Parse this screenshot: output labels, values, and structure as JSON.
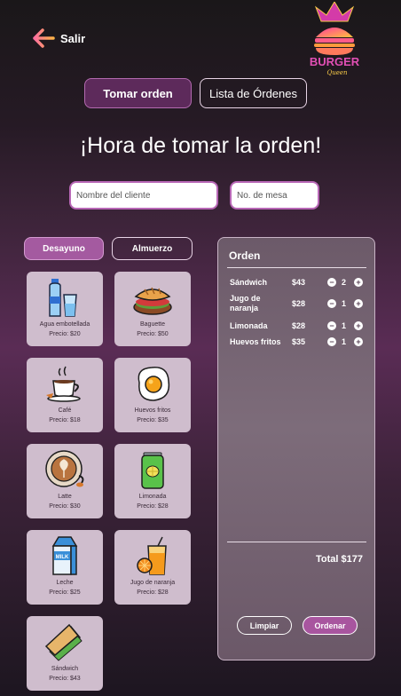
{
  "header": {
    "back_label": "Salir",
    "logo_text": "BURGER",
    "logo_subtext": "Queen"
  },
  "tabs": [
    {
      "label": "Tomar orden",
      "active": true
    },
    {
      "label": "Lista de Órdenes",
      "active": false
    }
  ],
  "heading": "¡Hora de tomar la orden!",
  "form": {
    "client_placeholder": "Nombre del cliente",
    "table_placeholder": "No. de mesa"
  },
  "categories": [
    {
      "label": "Desayuno",
      "active": true
    },
    {
      "label": "Almuerzo",
      "active": false
    }
  ],
  "products": [
    {
      "name": "Agua embotellada",
      "price": "Precio: $20",
      "icon": "water-bottle-icon"
    },
    {
      "name": "Baguette",
      "price": "Precio: $50",
      "icon": "baguette-icon"
    },
    {
      "name": "Café",
      "price": "Precio: $18",
      "icon": "coffee-cup-icon"
    },
    {
      "name": "Huevos fritos",
      "price": "Precio: $35",
      "icon": "fried-egg-icon"
    },
    {
      "name": "Latte",
      "price": "Precio: $30",
      "icon": "latte-icon"
    },
    {
      "name": "Limonada",
      "price": "Precio: $28",
      "icon": "lemonade-can-icon"
    },
    {
      "name": "Leche",
      "price": "Precio: $25",
      "icon": "milk-carton-icon"
    },
    {
      "name": "Jugo de naranja",
      "price": "Precio: $28",
      "icon": "orange-juice-icon"
    },
    {
      "name": "Sándwich",
      "price": "Precio: $43",
      "icon": "sandwich-icon"
    }
  ],
  "order": {
    "title": "Orden",
    "items": [
      {
        "name": "Sándwich",
        "price": "$43",
        "qty": "2"
      },
      {
        "name": "Jugo de naranja",
        "price": "$28",
        "qty": "1"
      },
      {
        "name": "Limonada",
        "price": "$28",
        "qty": "1"
      },
      {
        "name": "Huevos fritos",
        "price": "$35",
        "qty": "1"
      }
    ],
    "total": "Total $177",
    "clear_label": "Limpiar",
    "submit_label": "Ordenar",
    "minus_symbol": "−",
    "plus_symbol": "+"
  },
  "colors": {
    "accent": "#a45aa0",
    "tab_active": "#5d2a5b",
    "card_bg": "#cfbdcd"
  }
}
